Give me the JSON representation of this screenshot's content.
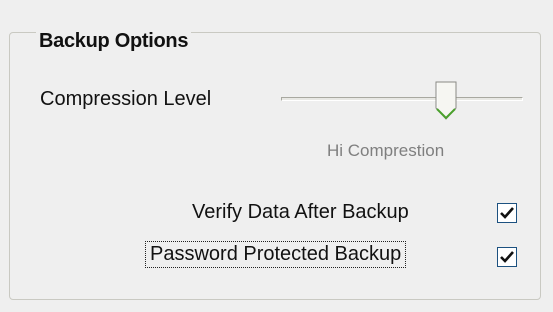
{
  "group": {
    "title": "Backup Options"
  },
  "compression": {
    "label": "Compression Level",
    "level_text": "Hi Comprestion",
    "level_fraction": 0.7
  },
  "options": [
    {
      "label": "Verify Data After Backup",
      "checked": true
    },
    {
      "label": "Password Protected Backup",
      "checked": true
    }
  ],
  "colors": {
    "background": "#efefef",
    "checkbox_border": "#1c5180",
    "thumb_green": "#4aa02c",
    "disabled_text": "#7f7f7f"
  }
}
